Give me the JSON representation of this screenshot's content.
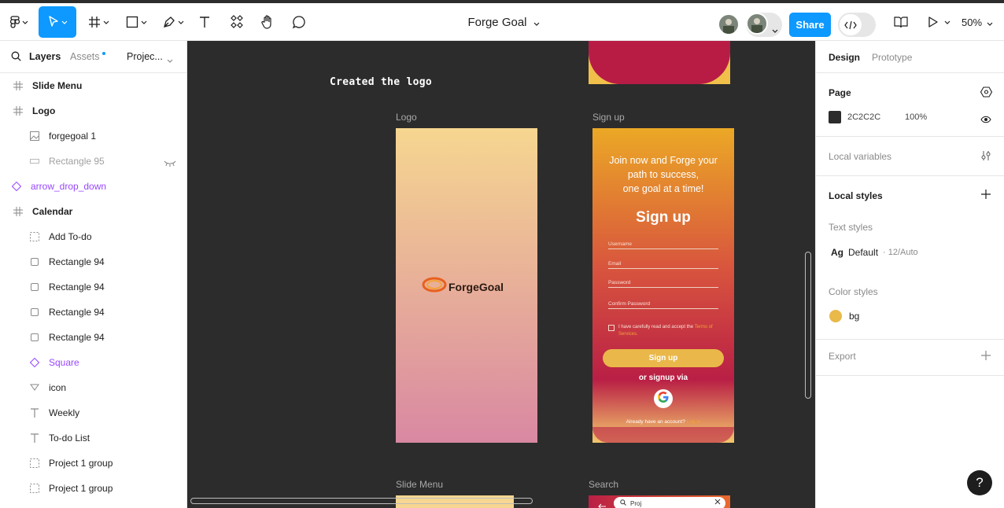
{
  "toolbar": {
    "file_title": "Forge Goal",
    "share_label": "Share",
    "zoom_level": "50%",
    "icons": [
      "figma-menu-icon",
      "move-tool-icon",
      "frame-tool-icon",
      "shape-tool-icon",
      "pen-tool-icon",
      "text-tool-icon",
      "resources-icon",
      "hand-tool-icon",
      "comment-icon",
      "dev-mode-icon",
      "library-icon",
      "present-icon"
    ],
    "accent_color": "#0d99ff"
  },
  "left_panel": {
    "tabs": {
      "layers": "Layers",
      "assets": "Assets",
      "pages": "Projec..."
    },
    "layers": [
      {
        "label": "Slide Menu",
        "icon": "frame-icon",
        "kind": "frame"
      },
      {
        "label": "Logo",
        "icon": "frame-icon",
        "kind": "frame"
      },
      {
        "label": "forgegoal 1",
        "icon": "image-icon",
        "kind": "child"
      },
      {
        "label": "Rectangle 95",
        "icon": "rectangle-icon",
        "kind": "hidden"
      },
      {
        "label": "arrow_drop_down",
        "icon": "component-icon",
        "kind": "component"
      },
      {
        "label": "Calendar",
        "icon": "frame-icon",
        "kind": "frame"
      },
      {
        "label": "Add To-do",
        "icon": "section-icon",
        "kind": "child"
      },
      {
        "label": "Rectangle 94",
        "icon": "rectangle-icon",
        "kind": "child"
      },
      {
        "label": "Rectangle 94",
        "icon": "rectangle-icon",
        "kind": "child"
      },
      {
        "label": "Rectangle 94",
        "icon": "rectangle-icon",
        "kind": "child"
      },
      {
        "label": "Rectangle 94",
        "icon": "rectangle-icon",
        "kind": "child"
      },
      {
        "label": "Square",
        "icon": "component-icon",
        "kind": "component-child"
      },
      {
        "label": "icon",
        "icon": "vector-icon",
        "kind": "child"
      },
      {
        "label": "Weekly",
        "icon": "text-icon",
        "kind": "child"
      },
      {
        "label": "To-do List",
        "icon": "text-icon",
        "kind": "child"
      },
      {
        "label": "Project 1 group",
        "icon": "group-icon",
        "kind": "child"
      },
      {
        "label": "Project 1 group",
        "icon": "group-icon",
        "kind": "child"
      }
    ]
  },
  "right_panel": {
    "tabs": {
      "design": "Design",
      "prototype": "Prototype"
    },
    "page": {
      "title": "Page",
      "color_hex": "2C2C2C",
      "opacity": "100%",
      "swatch": "#2c2c2c"
    },
    "local_variables": "Local variables",
    "local_styles": "Local styles",
    "text_styles": {
      "title": "Text styles",
      "sample": "Ag",
      "name": "Default",
      "meta": "· 12/Auto"
    },
    "color_styles": {
      "title": "Color styles",
      "name": "bg",
      "swatch": "#e9b949"
    },
    "export": "Export",
    "help": "?"
  },
  "canvas": {
    "note": "Created the logo",
    "frames": {
      "logo": "Logo",
      "signup": "Sign up",
      "slide_menu": "Slide Menu",
      "search": "Search"
    },
    "logo_wordmark": "ForgeGoal",
    "signup": {
      "tagline_1": "Join now and Forge your",
      "tagline_2": "path to success,",
      "tagline_3": "one goal at a time!",
      "heading": "Sign up",
      "fields": [
        "Username",
        "Email",
        "Password",
        "Confirm Password"
      ],
      "terms_text": "I have carefully read and accept the",
      "terms_link": "Terms of Services.",
      "button": "Sign up",
      "or_via": "or signup via",
      "have_account": "Already have an account?",
      "login_link": "Log in"
    },
    "search_placeholder": "Proj"
  }
}
